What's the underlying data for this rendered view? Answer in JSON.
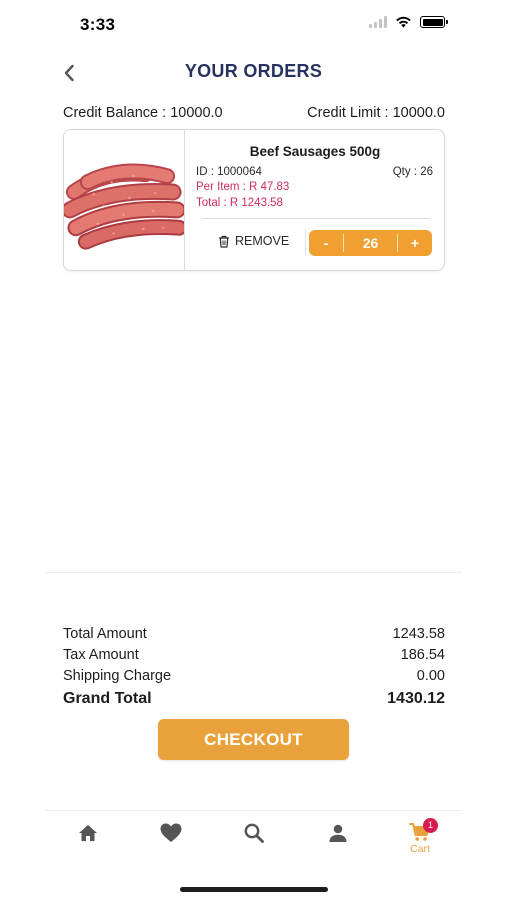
{
  "status_bar": {
    "time": "3:33"
  },
  "header": {
    "title": "YOUR ORDERS"
  },
  "credit": {
    "balance_text": "Credit Balance : 10000.0",
    "limit_text": "Credit Limit : 10000.0"
  },
  "cart_items": [
    {
      "name": "Beef Sausages 500g",
      "id_text": "ID : 1000064",
      "qty_text": "Qty : 26",
      "per_item_text": "Per Item : R 47.83",
      "total_text": "Total : R 1243.58",
      "remove_label": "REMOVE",
      "quantity": "26",
      "minus_label": "-",
      "plus_label": "+"
    }
  ],
  "summary": {
    "total_amount_label": "Total Amount",
    "total_amount_value": "1243.58",
    "tax_amount_label": "Tax Amount",
    "tax_amount_value": "186.54",
    "shipping_label": "Shipping Charge",
    "shipping_value": "0.00",
    "grand_total_label": "Grand Total",
    "grand_total_value": "1430.12"
  },
  "checkout_label": "CHECKOUT",
  "tabbar": {
    "cart_label": "Cart",
    "cart_badge": "1",
    "icons": [
      "home-icon",
      "heart-icon",
      "search-icon",
      "user-icon",
      "cart-icon"
    ]
  },
  "colors": {
    "accent": "#E9A23B",
    "title": "#27335E",
    "price": "#CF2B5B",
    "badge": "#D81B4F",
    "tab_icon": "#555555"
  }
}
